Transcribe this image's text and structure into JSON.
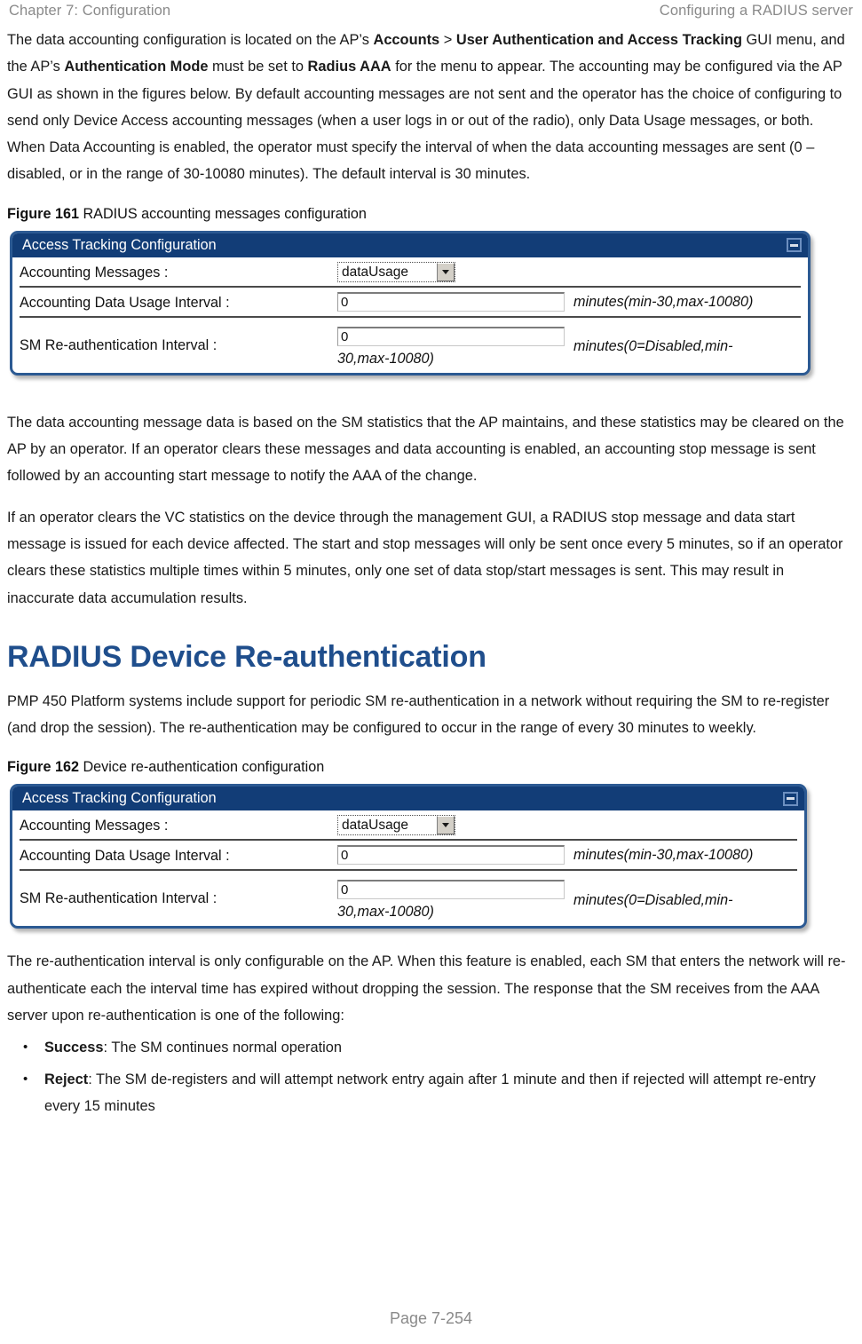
{
  "header": {
    "left": "Chapter 7:  Configuration",
    "right": "Configuring a RADIUS server"
  },
  "intro": {
    "p1_a": "The data accounting configuration is located on the AP’s ",
    "p1_b1": "Accounts",
    "p1_c": " > ",
    "p1_b2": "User Authentication and Access Tracking",
    "p1_d": " GUI menu, and the AP’s ",
    "p1_b3": "Authentication Mode",
    "p1_e": " must be set to ",
    "p1_b4": "Radius AAA",
    "p1_f": " for the menu to appear. The accounting may be configured via the AP GUI as shown in the figures below. By default accounting messages are not sent and the operator has the choice of configuring to send only Device Access accounting messages (when a user logs in or out of the radio), only Data Usage messages, or both. When Data Accounting is enabled, the operator must specify the interval of when the data accounting messages are sent (0 – disabled, or in the range of 30-10080 minutes). The default interval is 30 minutes."
  },
  "figure161": {
    "caption_num": "Figure 161",
    "caption_text": " RADIUS accounting messages configuration",
    "panel": {
      "title": "Access Tracking Configuration",
      "minimize_icon": "minimize-icon",
      "rows": [
        {
          "label": "Accounting Messages :",
          "control": "select",
          "value": "dataUsage",
          "units": ""
        },
        {
          "label": "Accounting Data Usage Interval :",
          "control": "input",
          "value": "0",
          "units": "minutes(min-30,max-10080)"
        },
        {
          "label": "SM Re-authentication Interval :",
          "control": "input",
          "value": "0",
          "units": "minutes(0=Disabled,min-",
          "units_line2": "30,max-10080)"
        }
      ]
    }
  },
  "middle": {
    "p2": "The data accounting message data is based on the SM statistics that the AP maintains, and these statistics may be cleared on the AP by an operator. If an operator clears these messages and data accounting is enabled, an accounting stop message is sent followed by an accounting start message to notify the AAA of the change.",
    "p3": "If an operator clears the VC statistics on the device through the management GUI, a RADIUS stop message and data start message is issued for each device affected. The start and stop messages will only be sent once every 5 minutes, so if an operator clears these statistics multiple times within 5 minutes, only one set of data stop/start messages is sent. This may result in inaccurate data accumulation results."
  },
  "section": {
    "heading": "RADIUS Device Re-authentication",
    "p4": "PMP 450 Platform systems include support for periodic SM re-authentication in a network without requiring the SM to re-register (and drop the session). The re-authentication may be configured to occur in the range of every 30 minutes to weekly."
  },
  "figure162": {
    "caption_num": "Figure 162",
    "caption_text": " Device re-authentication configuration",
    "panel": {
      "title": "Access Tracking Configuration",
      "minimize_icon": "minimize-icon",
      "rows": [
        {
          "label": "Accounting Messages :",
          "control": "select",
          "value": "dataUsage",
          "units": ""
        },
        {
          "label": "Accounting Data Usage Interval :",
          "control": "input",
          "value": "0",
          "units": "minutes(min-30,max-10080)"
        },
        {
          "label": "SM Re-authentication Interval :",
          "control": "input",
          "value": "0",
          "units": "minutes(0=Disabled,min-",
          "units_line2": "30,max-10080)"
        }
      ]
    }
  },
  "tail": {
    "p5": "The re-authentication interval is only configurable on the AP. When this feature is enabled, each SM that enters the network will re-authenticate each the interval time has expired without dropping the session. The response that the SM receives from the AAA server upon re-authentication is one of the following:",
    "bullets": [
      {
        "term": "Success",
        "rest": ": The SM continues normal operation"
      },
      {
        "term": "Reject",
        "rest": ": The SM de-registers and will attempt network entry again after 1 minute and then if rejected will attempt re-entry every 15 minutes"
      }
    ]
  },
  "footer": {
    "page_label": "Page 7-254"
  },
  "colors": {
    "heading_blue": "#1F4E8C",
    "panel_titlebar": "#123D77",
    "panel_border": "#2C5A93",
    "header_gray": "#8a8a8a"
  }
}
